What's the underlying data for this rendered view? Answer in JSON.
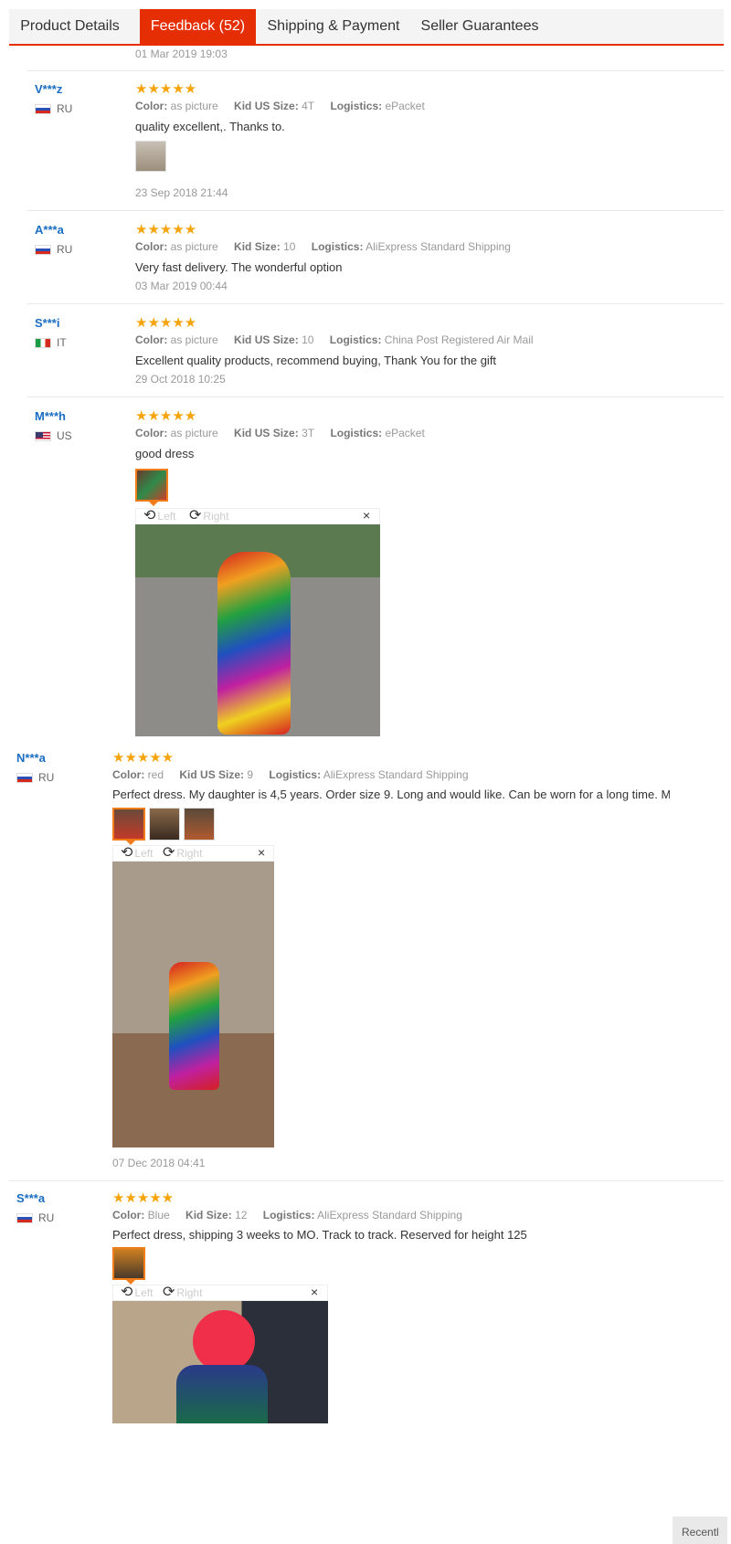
{
  "tabs": [
    {
      "label": "Product Details"
    },
    {
      "label": "Feedback (52)"
    },
    {
      "label": "Shipping & Payment"
    },
    {
      "label": "Seller Guarantees"
    }
  ],
  "prev_date": "01 Mar 2019 19:03",
  "stars": "★★★★★",
  "attr_labels": {
    "color": "Color:",
    "size_kid": "Kid US Size:",
    "size": "Kid Size:",
    "logistics": "Logistics:"
  },
  "viewer": {
    "left": "Left",
    "right": "Right",
    "close": "×"
  },
  "reviews": [
    {
      "name": "V***z",
      "country": "RU",
      "color": "as picture",
      "size": "4T",
      "logistics": "ePacket",
      "text": "quality excellent,. Thanks to.",
      "date": "23 Sep 2018 21:44"
    },
    {
      "name": "A***a",
      "country": "RU",
      "color": "as picture",
      "size": "10",
      "logistics": "AliExpress Standard Shipping",
      "text": "Very fast delivery. The wonderful option",
      "date": "03 Mar 2019 00:44"
    },
    {
      "name": "S***i",
      "country": "IT",
      "color": "as picture",
      "size": "10",
      "logistics": "China Post Registered Air Mail",
      "text": "Excellent quality products, recommend buying, Thank You for the gift",
      "date": "29 Oct 2018 10:25"
    },
    {
      "name": "M***h",
      "country": "US",
      "color": "as picture",
      "size": "3T",
      "logistics": "ePacket",
      "text": "good dress"
    },
    {
      "name": "N***a",
      "country": "RU",
      "color": "red",
      "size": "9",
      "logistics": "AliExpress Standard Shipping",
      "text": "Perfect dress. My daughter is 4,5 years. Order size 9. Long and would like. Can be worn for a long time. Month went smoothly",
      "date": "07 Dec 2018 04:41"
    },
    {
      "name": "S***a",
      "country": "RU",
      "color": "Blue",
      "size": "12",
      "logistics": "AliExpress Standard Shipping",
      "text": "Perfect dress, shipping 3 weeks to MO. Track to track. Reserved for height 125"
    }
  ],
  "recent_label": "Recentl",
  "colors": {
    "accent": "#e62e04",
    "star": "#f6a40c",
    "username": "#1a6dc2"
  }
}
